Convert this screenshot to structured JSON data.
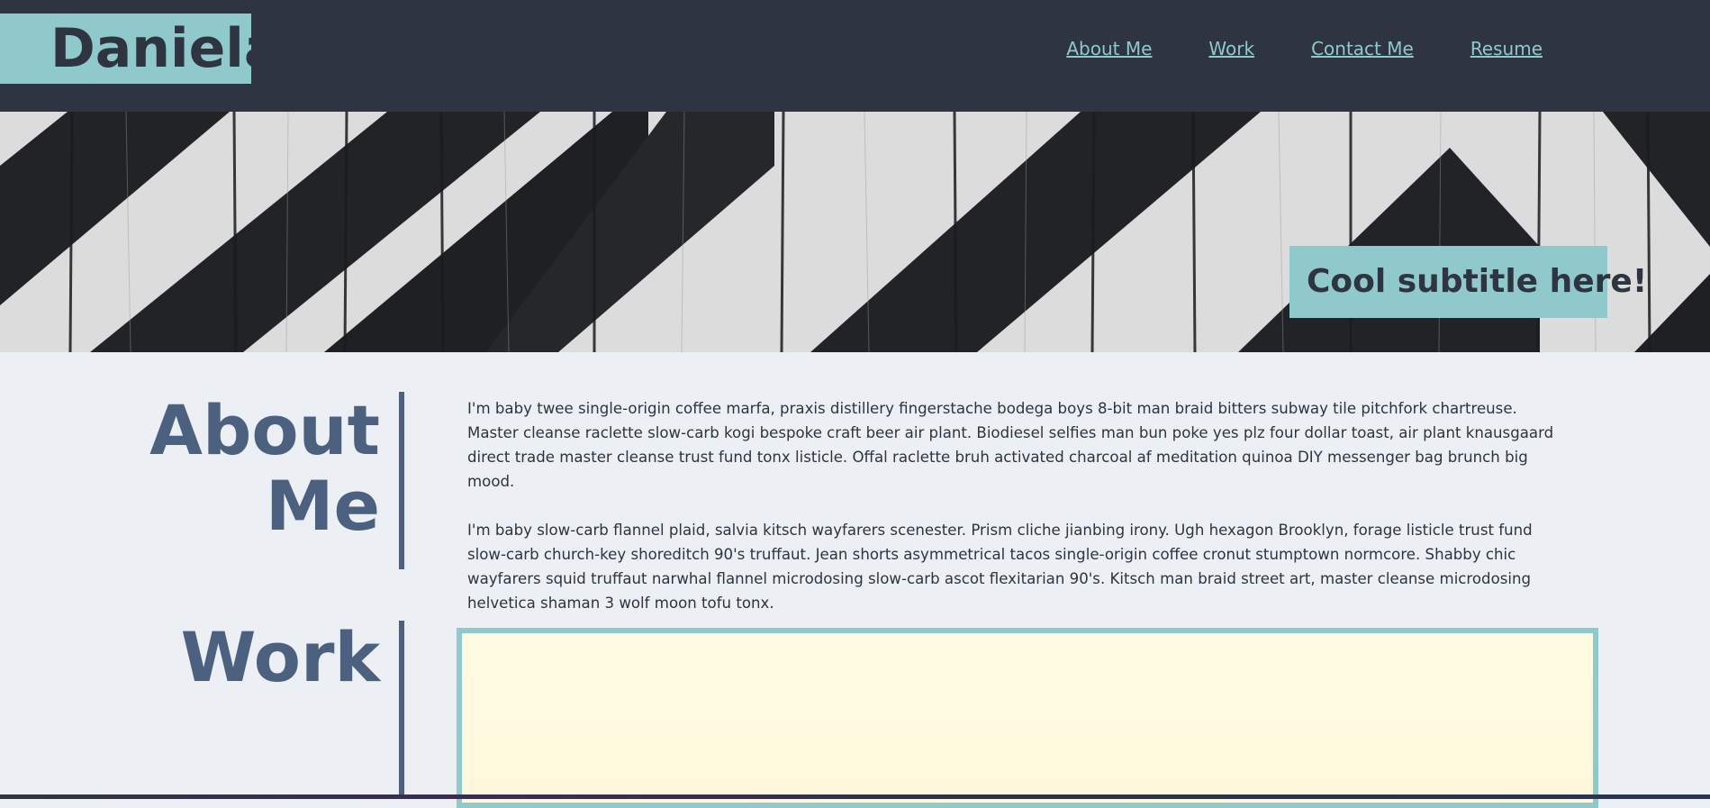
{
  "header": {
    "brand": "Daniela",
    "nav": [
      {
        "label": "About Me"
      },
      {
        "label": "Work"
      },
      {
        "label": "Contact Me"
      },
      {
        "label": "Resume"
      }
    ]
  },
  "hero": {
    "subtitle": "Cool subtitle here!"
  },
  "about": {
    "title": "About Me",
    "paragraphs": [
      "I'm baby twee single-origin coffee marfa, praxis distillery fingerstache bodega boys 8-bit man braid bitters subway tile pitchfork chartreuse. Master cleanse raclette slow-carb kogi bespoke craft beer air plant. Biodiesel selfies man bun poke yes plz four dollar toast, air plant knausgaard direct trade master cleanse trust fund tonx listicle. Offal raclette bruh activated charcoal af meditation quinoa DIY messenger bag brunch big mood.",
      "I'm baby slow-carb flannel plaid, salvia kitsch wayfarers scenester. Prism cliche jianbing irony. Ugh hexagon Brooklyn, forage listicle trust fund slow-carb church-key shoreditch 90's truffaut. Jean shorts asymmetrical tacos single-origin coffee cronut stumptown normcore. Shabby chic wayfarers squid truffaut narwhal flannel microdosing slow-carb ascot flexitarian 90's. Kitsch man braid street art, master cleanse microdosing helvetica shaman 3 wolf moon tofu tonx."
    ]
  },
  "work": {
    "title": "Work"
  },
  "colors": {
    "header_bg": "#2e3440",
    "accent": "#8fc9cb",
    "heading": "#4c607f",
    "page_bg": "#eceff4"
  }
}
